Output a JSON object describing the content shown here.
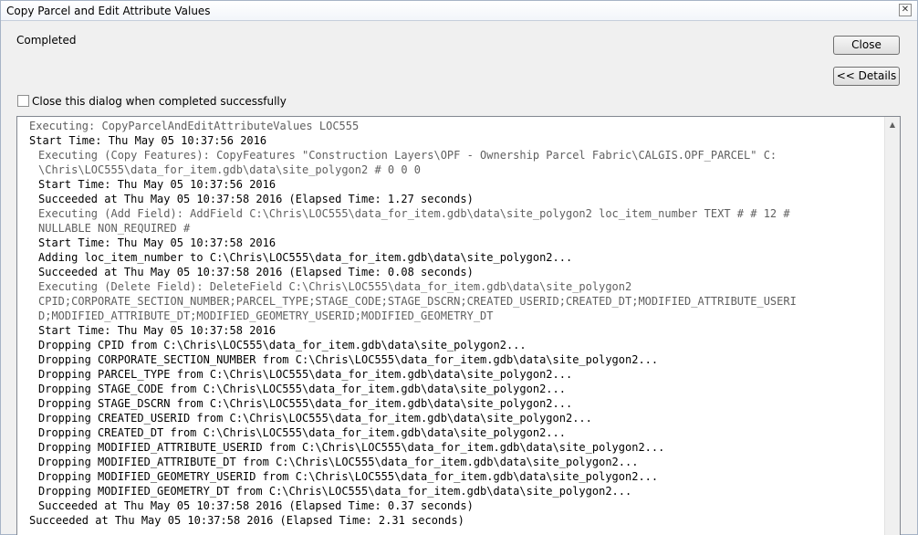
{
  "window": {
    "title": "Copy Parcel and Edit Attribute Values",
    "close_glyph": "✕"
  },
  "status": "Completed",
  "buttons": {
    "close": "Close",
    "details": "<< Details"
  },
  "checkbox": {
    "label": "Close this dialog when completed successfully",
    "checked": false
  },
  "scrollbar": {
    "up_glyph": "▲"
  },
  "log": [
    {
      "text": "Executing: CopyParcelAndEditAttributeValues LOC555",
      "indent": 0,
      "gray": true
    },
    {
      "text": "Start Time: Thu May 05 10:37:56 2016",
      "indent": 0,
      "gray": false
    },
    {
      "text": "Executing (Copy Features): CopyFeatures \"Construction Layers\\OPF - Ownership Parcel Fabric\\CALGIS.OPF_PARCEL\" C:",
      "indent": 1,
      "gray": true
    },
    {
      "text": "\\Chris\\LOC555\\data_for_item.gdb\\data\\site_polygon2 # 0 0 0",
      "indent": 1,
      "gray": true
    },
    {
      "text": "Start Time: Thu May 05 10:37:56 2016",
      "indent": 1,
      "gray": false
    },
    {
      "text": "Succeeded at Thu May 05 10:37:58 2016 (Elapsed Time: 1.27 seconds)",
      "indent": 1,
      "gray": false
    },
    {
      "text": "Executing (Add Field): AddField C:\\Chris\\LOC555\\data_for_item.gdb\\data\\site_polygon2 loc_item_number TEXT # # 12 #",
      "indent": 1,
      "gray": true
    },
    {
      "text": "NULLABLE NON_REQUIRED #",
      "indent": 1,
      "gray": true
    },
    {
      "text": "Start Time: Thu May 05 10:37:58 2016",
      "indent": 1,
      "gray": false
    },
    {
      "text": "Adding loc_item_number to C:\\Chris\\LOC555\\data_for_item.gdb\\data\\site_polygon2...",
      "indent": 1,
      "gray": false
    },
    {
      "text": "Succeeded at Thu May 05 10:37:58 2016 (Elapsed Time: 0.08 seconds)",
      "indent": 1,
      "gray": false
    },
    {
      "text": "Executing (Delete Field): DeleteField C:\\Chris\\LOC555\\data_for_item.gdb\\data\\site_polygon2",
      "indent": 1,
      "gray": true
    },
    {
      "text": "CPID;CORPORATE_SECTION_NUMBER;PARCEL_TYPE;STAGE_CODE;STAGE_DSCRN;CREATED_USERID;CREATED_DT;MODIFIED_ATTRIBUTE_USERI",
      "indent": 1,
      "gray": true
    },
    {
      "text": "D;MODIFIED_ATTRIBUTE_DT;MODIFIED_GEOMETRY_USERID;MODIFIED_GEOMETRY_DT",
      "indent": 1,
      "gray": true
    },
    {
      "text": "Start Time: Thu May 05 10:37:58 2016",
      "indent": 1,
      "gray": false
    },
    {
      "text": "Dropping CPID from C:\\Chris\\LOC555\\data_for_item.gdb\\data\\site_polygon2...",
      "indent": 1,
      "gray": false
    },
    {
      "text": "Dropping CORPORATE_SECTION_NUMBER from C:\\Chris\\LOC555\\data_for_item.gdb\\data\\site_polygon2...",
      "indent": 1,
      "gray": false
    },
    {
      "text": "Dropping PARCEL_TYPE from C:\\Chris\\LOC555\\data_for_item.gdb\\data\\site_polygon2...",
      "indent": 1,
      "gray": false
    },
    {
      "text": "Dropping STAGE_CODE from C:\\Chris\\LOC555\\data_for_item.gdb\\data\\site_polygon2...",
      "indent": 1,
      "gray": false
    },
    {
      "text": "Dropping STAGE_DSCRN from C:\\Chris\\LOC555\\data_for_item.gdb\\data\\site_polygon2...",
      "indent": 1,
      "gray": false
    },
    {
      "text": "Dropping CREATED_USERID from C:\\Chris\\LOC555\\data_for_item.gdb\\data\\site_polygon2...",
      "indent": 1,
      "gray": false
    },
    {
      "text": "Dropping CREATED_DT from C:\\Chris\\LOC555\\data_for_item.gdb\\data\\site_polygon2...",
      "indent": 1,
      "gray": false
    },
    {
      "text": "Dropping MODIFIED_ATTRIBUTE_USERID from C:\\Chris\\LOC555\\data_for_item.gdb\\data\\site_polygon2...",
      "indent": 1,
      "gray": false
    },
    {
      "text": "Dropping MODIFIED_ATTRIBUTE_DT from C:\\Chris\\LOC555\\data_for_item.gdb\\data\\site_polygon2...",
      "indent": 1,
      "gray": false
    },
    {
      "text": "Dropping MODIFIED_GEOMETRY_USERID from C:\\Chris\\LOC555\\data_for_item.gdb\\data\\site_polygon2...",
      "indent": 1,
      "gray": false
    },
    {
      "text": "Dropping MODIFIED_GEOMETRY_DT from C:\\Chris\\LOC555\\data_for_item.gdb\\data\\site_polygon2...",
      "indent": 1,
      "gray": false
    },
    {
      "text": "Succeeded at Thu May 05 10:37:58 2016 (Elapsed Time: 0.37 seconds)",
      "indent": 1,
      "gray": false
    },
    {
      "text": "Succeeded at Thu May 05 10:37:58 2016 (Elapsed Time: 2.31 seconds)",
      "indent": 0,
      "gray": false
    }
  ]
}
